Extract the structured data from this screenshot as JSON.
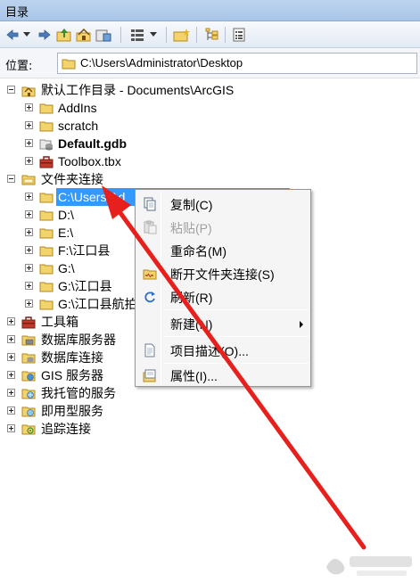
{
  "window": {
    "title": "目录"
  },
  "location": {
    "label": "位置:",
    "value": "C:\\Users\\Administrator\\Desktop"
  },
  "tree": {
    "default_home": {
      "label": "默认工作目录 - Documents\\ArcGIS"
    },
    "addins": {
      "label": "AddIns"
    },
    "scratch": {
      "label": "scratch"
    },
    "default_gdb": {
      "label": "Default.gdb"
    },
    "toolbox_tbx": {
      "label": "Toolbox.tbx"
    },
    "folder_connections": {
      "label": "文件夹连接"
    },
    "conn_users": {
      "label": "C:\\Users\\Ad"
    },
    "conn_d": {
      "label": "D:\\"
    },
    "conn_e": {
      "label": "E:\\"
    },
    "conn_f": {
      "label": "F:\\江口县"
    },
    "conn_g": {
      "label": "G:\\"
    },
    "conn_g2": {
      "label": "G:\\江口县"
    },
    "conn_g3": {
      "label": "G:\\江口县航拍"
    },
    "toolboxes": {
      "label": "工具箱"
    },
    "db_servers": {
      "label": "数据库服务器"
    },
    "db_connections": {
      "label": "数据库连接"
    },
    "gis_servers": {
      "label": "GIS 服务器"
    },
    "my_hosted": {
      "label": "我托管的服务"
    },
    "ready_to_use": {
      "label": "即用型服务"
    },
    "tracking": {
      "label": "追踪连接"
    }
  },
  "context_menu": {
    "copy": "复制(C)",
    "paste": "粘贴(P)",
    "rename": "重命名(M)",
    "disconnect": "断开文件夹连接(S)",
    "refresh": "刷新(R)",
    "new": "新建(N)",
    "item_desc": "项目描述(O)...",
    "properties": "属性(I)..."
  },
  "colors": {
    "selection": "#3399ff",
    "annotation_arrow": "#e8201d",
    "titlebar": "#bcd3ee"
  }
}
